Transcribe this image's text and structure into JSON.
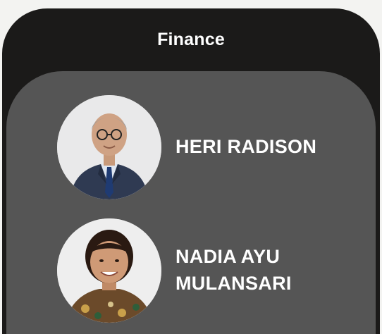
{
  "card": {
    "title": "Finance"
  },
  "members": [
    {
      "name": "HERI RADISON",
      "avatar_icon": "person-photo-icon"
    },
    {
      "name": "NADIA AYU\nMULANSARI",
      "avatar_icon": "person-photo-icon"
    }
  ],
  "colors": {
    "card_background": "#1b1a19",
    "panel_background": "#555555",
    "text": "#ffffff"
  }
}
